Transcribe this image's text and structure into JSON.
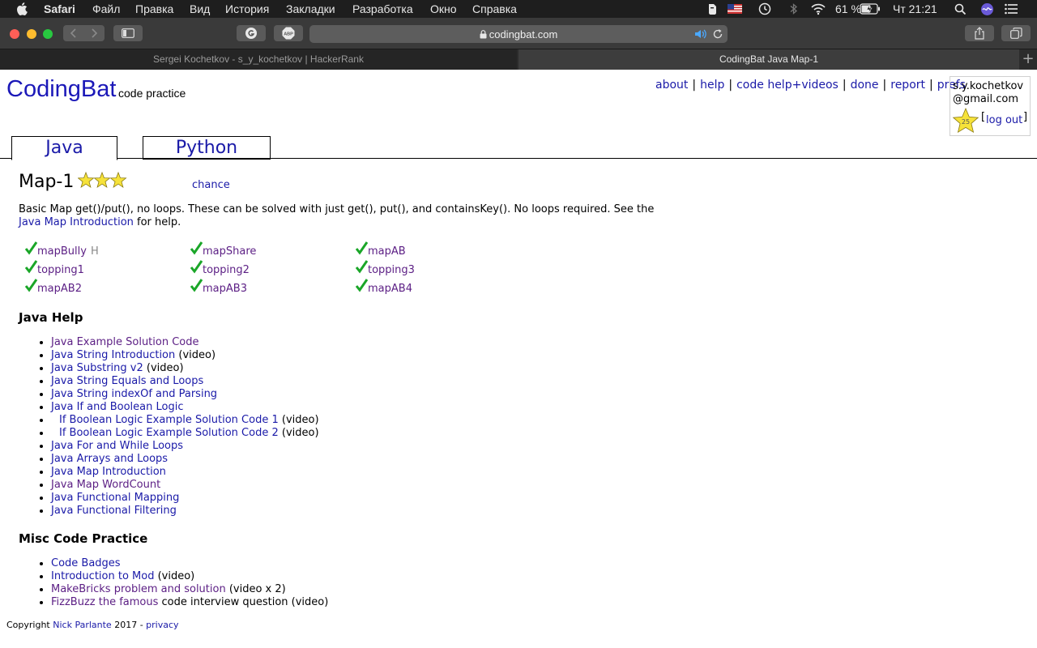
{
  "menubar": {
    "app": "Safari",
    "items": [
      "Файл",
      "Правка",
      "Вид",
      "История",
      "Закладки",
      "Разработка",
      "Окно",
      "Справка"
    ],
    "battery": "61 %",
    "clock": "Чт 21:21"
  },
  "browser": {
    "url": "codingbat.com",
    "tabs": [
      {
        "title": "Sergei Kochetkov - s_y_kochetkov | HackerRank",
        "active": false
      },
      {
        "title": "CodingBat Java Map-1",
        "active": true
      }
    ]
  },
  "site": {
    "logo": "CodingBat",
    "tagline": "code practice",
    "nav": [
      "about",
      "help",
      "code help+videos",
      "done",
      "report",
      "prefs"
    ],
    "user": {
      "email_line1": "s.y.kochetkov",
      "email_line2": "@gmail.com",
      "badge_value": "25",
      "logout": "log out"
    },
    "lang_tabs": [
      "Java",
      "Python"
    ]
  },
  "section": {
    "title": "Map-1",
    "stars": 3,
    "chance": "chance",
    "desc_text": "Basic Map get()/put(), no loops. These can be solved with just get(), put(), and containsKey(). No loops required. See the ",
    "desc_link": "Java Map Introduction",
    "desc_tail": " for help."
  },
  "problems": [
    {
      "name": "mapBully",
      "suffix": "H",
      "done": true
    },
    {
      "name": "mapShare",
      "suffix": "",
      "done": true
    },
    {
      "name": "mapAB",
      "suffix": "",
      "done": true
    },
    {
      "name": "topping1",
      "suffix": "",
      "done": true
    },
    {
      "name": "topping2",
      "suffix": "",
      "done": true
    },
    {
      "name": "topping3",
      "suffix": "",
      "done": true
    },
    {
      "name": "mapAB2",
      "suffix": "",
      "done": true
    },
    {
      "name": "mapAB3",
      "suffix": "",
      "done": true
    },
    {
      "name": "mapAB4",
      "suffix": "",
      "done": true
    }
  ],
  "java_help": {
    "heading": "Java Help",
    "items": [
      {
        "link": "Java Example Solution Code",
        "note": ""
      },
      {
        "link": "Java String Introduction",
        "note": " (video)"
      },
      {
        "link": "Java Substring v2",
        "note": " (video)"
      },
      {
        "link": "Java String Equals and Loops",
        "note": ""
      },
      {
        "link": "Java String indexOf and Parsing",
        "note": ""
      },
      {
        "link": "Java If and Boolean Logic",
        "note": ""
      },
      {
        "link": "If Boolean Logic Example Solution Code 1",
        "note": " (video)"
      },
      {
        "link": "If Boolean Logic Example Solution Code 2",
        "note": " (video)"
      },
      {
        "link": "Java For and While Loops",
        "note": ""
      },
      {
        "link": "Java Arrays and Loops",
        "note": ""
      },
      {
        "link": "Java Map Introduction",
        "note": ""
      },
      {
        "link": "Java Map WordCount",
        "note": ""
      },
      {
        "link": "Java Functional Mapping",
        "note": ""
      },
      {
        "link": "Java Functional Filtering",
        "note": ""
      }
    ]
  },
  "misc": {
    "heading": "Misc Code Practice",
    "items": [
      {
        "link": "Code Badges",
        "note": ""
      },
      {
        "link": "Introduction to Mod",
        "note": " (video)"
      },
      {
        "link": "MakeBricks problem and solution",
        "note": " (video x 2)"
      },
      {
        "link": "FizzBuzz the famous",
        "note": " code interview question (video)"
      }
    ]
  },
  "footer": {
    "prefix": "Copyright ",
    "author": "Nick Parlante",
    "year": " 2017 - ",
    "privacy": "privacy"
  },
  "colors": {
    "link": "#1a1aa8",
    "visited_link": "#5b1e84",
    "check": "#1aa628",
    "star": "#f6e23a"
  }
}
